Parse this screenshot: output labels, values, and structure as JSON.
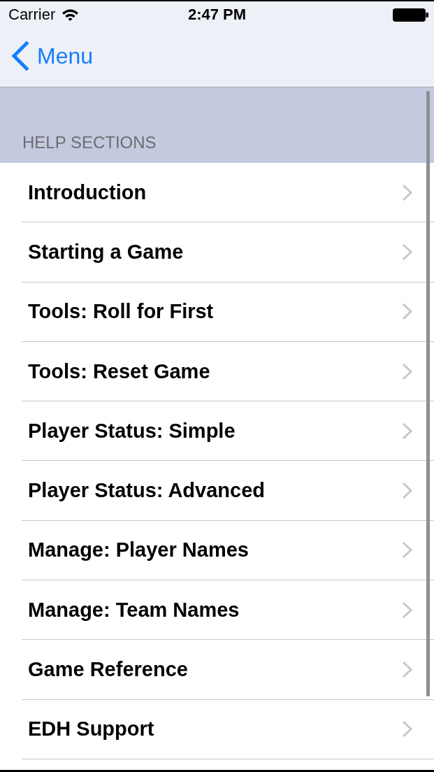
{
  "status_bar": {
    "carrier": "Carrier",
    "time": "2:47 PM"
  },
  "nav_bar": {
    "back_button": "Menu"
  },
  "section": {
    "header": "HELP SECTIONS",
    "items": [
      {
        "label": "Introduction"
      },
      {
        "label": "Starting a Game"
      },
      {
        "label": "Tools: Roll for First"
      },
      {
        "label": "Tools: Reset Game"
      },
      {
        "label": "Player Status: Simple"
      },
      {
        "label": "Player Status: Advanced"
      },
      {
        "label": "Manage: Player Names"
      },
      {
        "label": "Manage: Team Names"
      },
      {
        "label": "Game Reference"
      },
      {
        "label": "EDH Support"
      }
    ]
  }
}
